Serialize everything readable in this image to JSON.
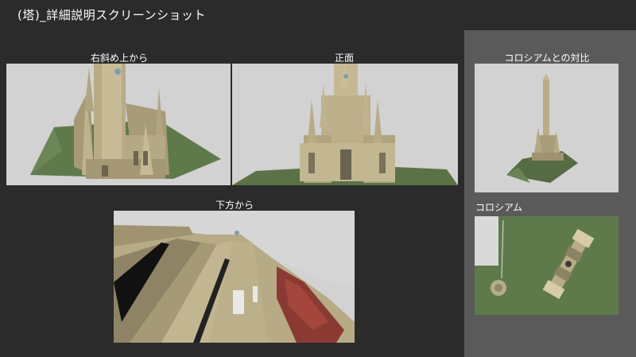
{
  "page": {
    "title": "(塔)_詳細説明スクリーンショット"
  },
  "views": {
    "diagonal": {
      "label": "右斜め上から"
    },
    "front": {
      "label": "正面"
    },
    "below": {
      "label": "下方から"
    },
    "comparison": {
      "label": "コロシアムとの対比"
    },
    "colosseum": {
      "label": "コロシアム"
    }
  }
}
